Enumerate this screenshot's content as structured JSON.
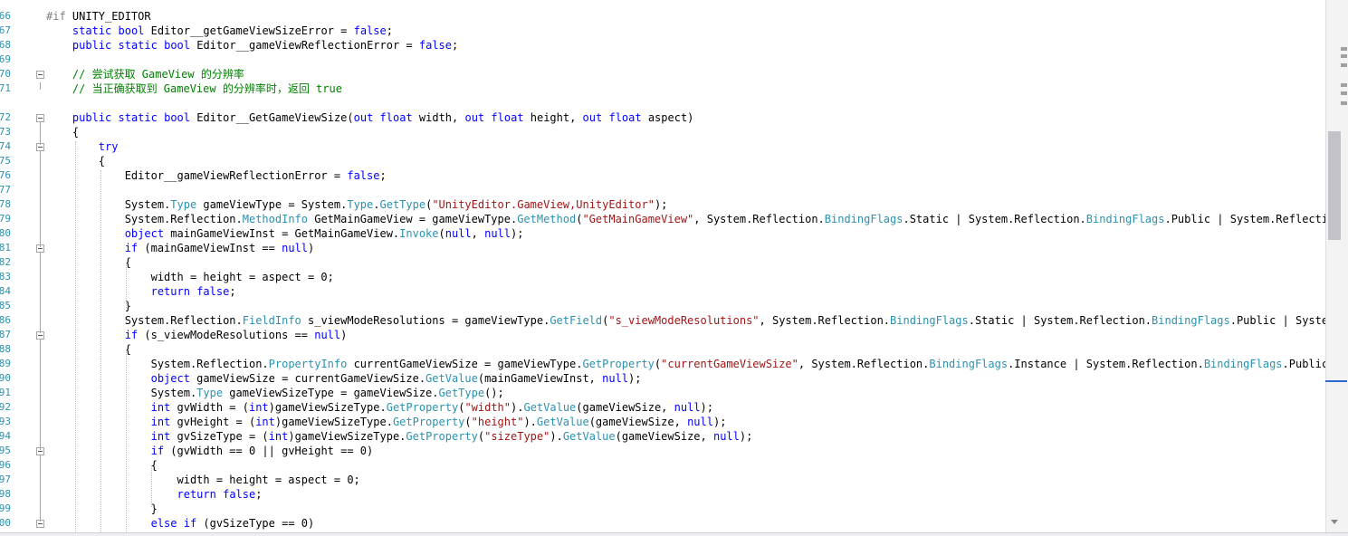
{
  "editor": {
    "line_numbers": [
      "66",
      "67",
      "68",
      "69",
      "70",
      "71",
      "72",
      "73",
      "74",
      "75",
      "76",
      "77",
      "78",
      "79",
      "80",
      "81",
      "82",
      "83",
      "84",
      "85",
      "86",
      "87",
      "88",
      "89",
      "90",
      "91",
      "92",
      "93",
      "94",
      "95",
      "96",
      "97",
      "98",
      "99",
      "00"
    ],
    "code_lines": [
      [
        {
          "t": "#if ",
          "c": "pp"
        },
        {
          "t": "UNITY_EDITOR",
          "c": ""
        }
      ],
      [
        {
          "t": "    ",
          "c": ""
        },
        {
          "t": "static",
          "c": "kw"
        },
        {
          "t": " ",
          "c": ""
        },
        {
          "t": "bool",
          "c": "kw"
        },
        {
          "t": " Editor__getGameViewSizeError = ",
          "c": ""
        },
        {
          "t": "false",
          "c": "kw"
        },
        {
          "t": ";",
          "c": ""
        }
      ],
      [
        {
          "t": "    ",
          "c": ""
        },
        {
          "t": "public",
          "c": "kw"
        },
        {
          "t": " ",
          "c": ""
        },
        {
          "t": "static",
          "c": "kw"
        },
        {
          "t": " ",
          "c": ""
        },
        {
          "t": "bool",
          "c": "kw"
        },
        {
          "t": " Editor__gameViewReflectionError = ",
          "c": ""
        },
        {
          "t": "false",
          "c": "kw"
        },
        {
          "t": ";",
          "c": ""
        }
      ],
      [],
      [
        {
          "t": "    ",
          "c": ""
        },
        {
          "t": "// 尝试获取 GameView 的分辨率",
          "c": "cm"
        }
      ],
      [
        {
          "t": "    ",
          "c": ""
        },
        {
          "t": "// 当正确获取到 GameView 的分辨率时，返回 true",
          "c": "cm"
        }
      ],
      [
        {
          "t": "    ",
          "c": ""
        },
        {
          "t": "public",
          "c": "kw"
        },
        {
          "t": " ",
          "c": ""
        },
        {
          "t": "static",
          "c": "kw"
        },
        {
          "t": " ",
          "c": ""
        },
        {
          "t": "bool",
          "c": "kw"
        },
        {
          "t": " Editor__GetGameViewSize(",
          "c": ""
        },
        {
          "t": "out",
          "c": "kw"
        },
        {
          "t": " ",
          "c": ""
        },
        {
          "t": "float",
          "c": "kw"
        },
        {
          "t": " width, ",
          "c": ""
        },
        {
          "t": "out",
          "c": "kw"
        },
        {
          "t": " ",
          "c": ""
        },
        {
          "t": "float",
          "c": "kw"
        },
        {
          "t": " height, ",
          "c": ""
        },
        {
          "t": "out",
          "c": "kw"
        },
        {
          "t": " ",
          "c": ""
        },
        {
          "t": "float",
          "c": "kw"
        },
        {
          "t": " aspect)",
          "c": ""
        }
      ],
      [
        {
          "t": "    {",
          "c": ""
        }
      ],
      [
        {
          "t": "        ",
          "c": ""
        },
        {
          "t": "try",
          "c": "kw"
        }
      ],
      [
        {
          "t": "        {",
          "c": ""
        }
      ],
      [
        {
          "t": "            Editor__gameViewReflectionError = ",
          "c": ""
        },
        {
          "t": "false",
          "c": "kw"
        },
        {
          "t": ";",
          "c": ""
        }
      ],
      [],
      [
        {
          "t": "            System.",
          "c": ""
        },
        {
          "t": "Type",
          "c": "ty"
        },
        {
          "t": " gameViewType = System.",
          "c": ""
        },
        {
          "t": "Type",
          "c": "ty"
        },
        {
          "t": ".",
          "c": ""
        },
        {
          "t": "GetType",
          "c": "ty"
        },
        {
          "t": "(",
          "c": ""
        },
        {
          "t": "\"UnityEditor.GameView,UnityEditor\"",
          "c": "str"
        },
        {
          "t": ");",
          "c": ""
        }
      ],
      [
        {
          "t": "            System.Reflection.",
          "c": ""
        },
        {
          "t": "MethodInfo",
          "c": "ty"
        },
        {
          "t": " GetMainGameView = gameViewType.",
          "c": ""
        },
        {
          "t": "GetMethod",
          "c": "ty"
        },
        {
          "t": "(",
          "c": ""
        },
        {
          "t": "\"GetMainGameView\"",
          "c": "str"
        },
        {
          "t": ", System.Reflection.",
          "c": ""
        },
        {
          "t": "BindingFlags",
          "c": "ty"
        },
        {
          "t": ".Static | System.Reflection.",
          "c": ""
        },
        {
          "t": "BindingFlags",
          "c": "ty"
        },
        {
          "t": ".Public | System.Reflection.",
          "c": ""
        },
        {
          "t": "Bin",
          "c": "ty"
        }
      ],
      [
        {
          "t": "            ",
          "c": ""
        },
        {
          "t": "object",
          "c": "kw"
        },
        {
          "t": " mainGameViewInst = GetMainGameView.",
          "c": ""
        },
        {
          "t": "Invoke",
          "c": "ty"
        },
        {
          "t": "(",
          "c": ""
        },
        {
          "t": "null",
          "c": "kw"
        },
        {
          "t": ", ",
          "c": ""
        },
        {
          "t": "null",
          "c": "kw"
        },
        {
          "t": ");",
          "c": ""
        }
      ],
      [
        {
          "t": "            ",
          "c": ""
        },
        {
          "t": "if",
          "c": "kw"
        },
        {
          "t": " (mainGameViewInst == ",
          "c": ""
        },
        {
          "t": "null",
          "c": "kw"
        },
        {
          "t": ")",
          "c": ""
        }
      ],
      [
        {
          "t": "            {",
          "c": ""
        }
      ],
      [
        {
          "t": "                width = height = aspect = 0;",
          "c": ""
        }
      ],
      [
        {
          "t": "                ",
          "c": ""
        },
        {
          "t": "return",
          "c": "kw"
        },
        {
          "t": " ",
          "c": ""
        },
        {
          "t": "false",
          "c": "kw"
        },
        {
          "t": ";",
          "c": ""
        }
      ],
      [
        {
          "t": "            }",
          "c": ""
        }
      ],
      [
        {
          "t": "            System.Reflection.",
          "c": ""
        },
        {
          "t": "FieldInfo",
          "c": "ty"
        },
        {
          "t": " s_viewModeResolutions = gameViewType.",
          "c": ""
        },
        {
          "t": "GetField",
          "c": "ty"
        },
        {
          "t": "(",
          "c": ""
        },
        {
          "t": "\"s_viewModeResolutions\"",
          "c": "str"
        },
        {
          "t": ", System.Reflection.",
          "c": ""
        },
        {
          "t": "BindingFlags",
          "c": "ty"
        },
        {
          "t": ".Static | System.Reflection.",
          "c": ""
        },
        {
          "t": "BindingFlags",
          "c": "ty"
        },
        {
          "t": ".Public | System.Refl",
          "c": ""
        }
      ],
      [
        {
          "t": "            ",
          "c": ""
        },
        {
          "t": "if",
          "c": "kw"
        },
        {
          "t": " (s_viewModeResolutions == ",
          "c": ""
        },
        {
          "t": "null",
          "c": "kw"
        },
        {
          "t": ")",
          "c": ""
        }
      ],
      [
        {
          "t": "            {",
          "c": ""
        }
      ],
      [
        {
          "t": "                System.Reflection.",
          "c": ""
        },
        {
          "t": "PropertyInfo",
          "c": "ty"
        },
        {
          "t": " currentGameViewSize = gameViewType.",
          "c": ""
        },
        {
          "t": "GetProperty",
          "c": "ty"
        },
        {
          "t": "(",
          "c": ""
        },
        {
          "t": "\"currentGameViewSize\"",
          "c": "str"
        },
        {
          "t": ", System.Reflection.",
          "c": ""
        },
        {
          "t": "BindingFlags",
          "c": "ty"
        },
        {
          "t": ".Instance | System.Reflection.",
          "c": ""
        },
        {
          "t": "BindingFlags",
          "c": "ty"
        },
        {
          "t": ".Public | Sys",
          "c": ""
        }
      ],
      [
        {
          "t": "                ",
          "c": ""
        },
        {
          "t": "object",
          "c": "kw"
        },
        {
          "t": " gameViewSize = currentGameViewSize.",
          "c": ""
        },
        {
          "t": "GetValue",
          "c": "ty"
        },
        {
          "t": "(mainGameViewInst, ",
          "c": ""
        },
        {
          "t": "null",
          "c": "kw"
        },
        {
          "t": ");",
          "c": ""
        }
      ],
      [
        {
          "t": "                System.",
          "c": ""
        },
        {
          "t": "Type",
          "c": "ty"
        },
        {
          "t": " gameViewSizeType = gameViewSize.",
          "c": ""
        },
        {
          "t": "GetType",
          "c": "ty"
        },
        {
          "t": "();",
          "c": ""
        }
      ],
      [
        {
          "t": "                ",
          "c": ""
        },
        {
          "t": "int",
          "c": "kw"
        },
        {
          "t": " gvWidth = (",
          "c": ""
        },
        {
          "t": "int",
          "c": "kw"
        },
        {
          "t": ")gameViewSizeType.",
          "c": ""
        },
        {
          "t": "GetProperty",
          "c": "ty"
        },
        {
          "t": "(",
          "c": ""
        },
        {
          "t": "\"width\"",
          "c": "str"
        },
        {
          "t": ").",
          "c": ""
        },
        {
          "t": "GetValue",
          "c": "ty"
        },
        {
          "t": "(gameViewSize, ",
          "c": ""
        },
        {
          "t": "null",
          "c": "kw"
        },
        {
          "t": ");",
          "c": ""
        }
      ],
      [
        {
          "t": "                ",
          "c": ""
        },
        {
          "t": "int",
          "c": "kw"
        },
        {
          "t": " gvHeight = (",
          "c": ""
        },
        {
          "t": "int",
          "c": "kw"
        },
        {
          "t": ")gameViewSizeType.",
          "c": ""
        },
        {
          "t": "GetProperty",
          "c": "ty"
        },
        {
          "t": "(",
          "c": ""
        },
        {
          "t": "\"height\"",
          "c": "str"
        },
        {
          "t": ").",
          "c": ""
        },
        {
          "t": "GetValue",
          "c": "ty"
        },
        {
          "t": "(gameViewSize, ",
          "c": ""
        },
        {
          "t": "null",
          "c": "kw"
        },
        {
          "t": ");",
          "c": ""
        }
      ],
      [
        {
          "t": "                ",
          "c": ""
        },
        {
          "t": "int",
          "c": "kw"
        },
        {
          "t": " gvSizeType = (",
          "c": ""
        },
        {
          "t": "int",
          "c": "kw"
        },
        {
          "t": ")gameViewSizeType.",
          "c": ""
        },
        {
          "t": "GetProperty",
          "c": "ty"
        },
        {
          "t": "(",
          "c": ""
        },
        {
          "t": "\"sizeType\"",
          "c": "str"
        },
        {
          "t": ").",
          "c": ""
        },
        {
          "t": "GetValue",
          "c": "ty"
        },
        {
          "t": "(gameViewSize, ",
          "c": ""
        },
        {
          "t": "null",
          "c": "kw"
        },
        {
          "t": ");",
          "c": ""
        }
      ],
      [
        {
          "t": "                ",
          "c": ""
        },
        {
          "t": "if",
          "c": "kw"
        },
        {
          "t": " (gvWidth == 0 || gvHeight == 0)",
          "c": ""
        }
      ],
      [
        {
          "t": "                {",
          "c": ""
        }
      ],
      [
        {
          "t": "                    width = height = aspect = 0;",
          "c": ""
        }
      ],
      [
        {
          "t": "                    ",
          "c": ""
        },
        {
          "t": "return",
          "c": "kw"
        },
        {
          "t": " ",
          "c": ""
        },
        {
          "t": "false",
          "c": "kw"
        },
        {
          "t": ";",
          "c": ""
        }
      ],
      [
        {
          "t": "                }",
          "c": ""
        }
      ],
      [
        {
          "t": "                ",
          "c": ""
        },
        {
          "t": "else",
          "c": "kw"
        },
        {
          "t": " ",
          "c": ""
        },
        {
          "t": "if",
          "c": "kw"
        },
        {
          "t": " (gvSizeType == 0)",
          "c": ""
        }
      ]
    ]
  },
  "colors": {
    "keyword": "#0000ff",
    "type": "#2b91af",
    "string": "#a31515",
    "comment": "#008000",
    "preprocessor": "#808080",
    "line_number": "#2b91af"
  }
}
